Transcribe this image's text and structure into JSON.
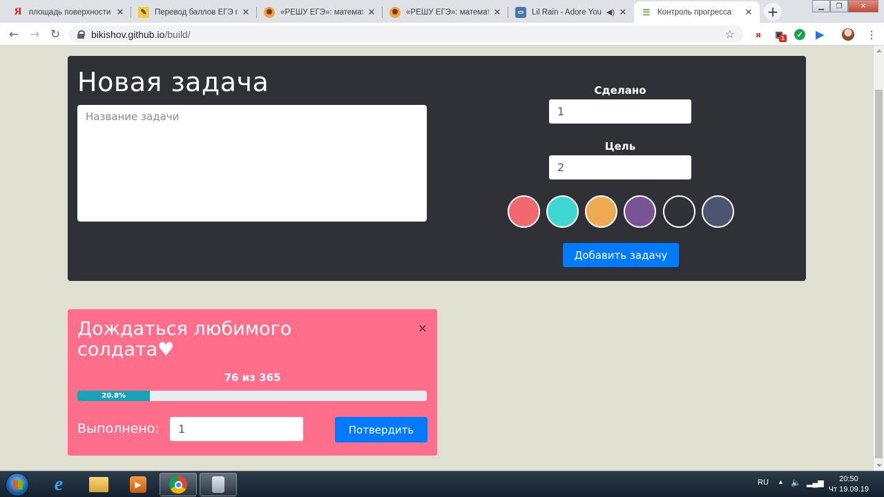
{
  "browser": {
    "tabs": [
      {
        "title": "площадь поверхности п",
        "icon": "yandex-icon"
      },
      {
        "title": "Перевод баллов ЕГЭ по",
        "icon": "ege-icon"
      },
      {
        "title": "«РЕШУ ЕГЭ»: математик",
        "icon": "reshu-ege-icon"
      },
      {
        "title": "«РЕШУ ЕГЭ»: математик",
        "icon": "reshu-ege-icon"
      },
      {
        "title": "Lil Rain - Adore You",
        "icon": "vk-icon"
      },
      {
        "title": "Контроль прогресса",
        "icon": "page-icon",
        "active": true
      }
    ],
    "url_host": "bikishov.github.io",
    "url_path": "/build/",
    "extension_badge": "1"
  },
  "new_task": {
    "title": "Новая задача",
    "name_placeholder": "Название задачи",
    "done_label": "Сделано",
    "done_value": "1",
    "goal_label": "Цель",
    "goal_value": "2",
    "colors": [
      "#f0676d",
      "#3fd7d3",
      "#f0ab52",
      "#7a5394",
      "#2f3136",
      "#4a5670"
    ],
    "add_button": "Добавить задачу"
  },
  "task_card": {
    "title": "Дождаться любимого солдата♥",
    "close_symbol": "×",
    "progress_text": "76 из 365",
    "progress_percent_label": "20.8%",
    "progress_fraction": 0.208,
    "completed_label": "Выполнено:",
    "completed_value": "1",
    "confirm_button": "Потвердить",
    "color": "#ff6f8c"
  },
  "taskbar": {
    "language": "RU",
    "time": "20:50",
    "date": "Чт 19.09.19"
  }
}
